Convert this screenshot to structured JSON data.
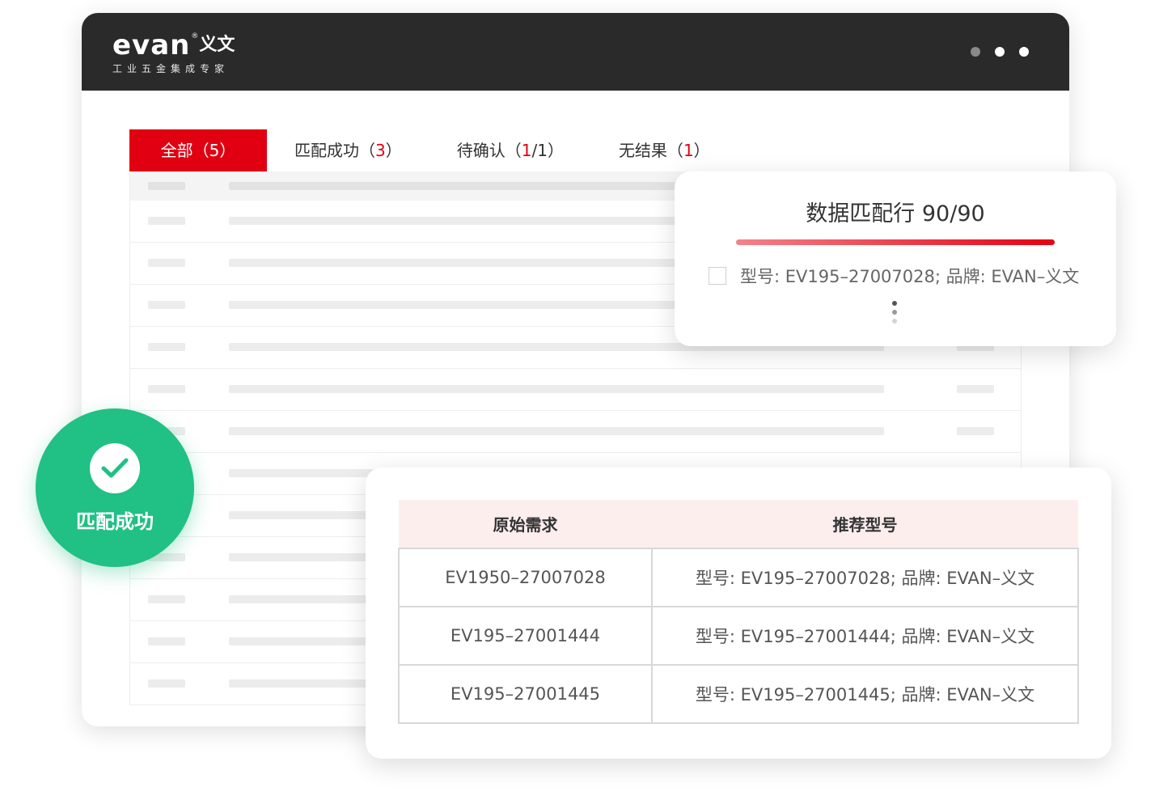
{
  "app": {
    "logo_word": "evan",
    "logo_cn": "义文",
    "logo_reg": "®",
    "logo_tagline": "工业五金集成专家"
  },
  "tabs": [
    {
      "label": "全部（",
      "count": "5",
      "suffix": "）",
      "active": true
    },
    {
      "label": "匹配成功（",
      "count": "3",
      "suffix": "）",
      "active": false
    },
    {
      "label": "待确认（",
      "count": "1",
      "count_rest": "/1",
      "suffix": "）",
      "active": false
    },
    {
      "label": "无结果（",
      "count": "1",
      "suffix": "）",
      "active": false
    }
  ],
  "progress_card": {
    "title": "数据匹配行 90/90",
    "progress": 1.0,
    "item_text": "型号: EV195–27007028; 品牌: EVAN–义文"
  },
  "success_badge": {
    "label": "匹配成功"
  },
  "result_table": {
    "headers": [
      "原始需求",
      "推荐型号"
    ],
    "rows": [
      [
        "EV1950–27007028",
        "型号: EV195–27007028; 品牌: EVAN–义文"
      ],
      [
        "EV195–27001444",
        "型号: EV195–27001444; 品牌: EVAN–义文"
      ],
      [
        "EV195–27001445",
        "型号: EV195–27001445; 品牌: EVAN–义文"
      ]
    ]
  },
  "colors": {
    "accent": "#e10012",
    "success": "#21c084",
    "titlebar": "#2a2a2a"
  }
}
